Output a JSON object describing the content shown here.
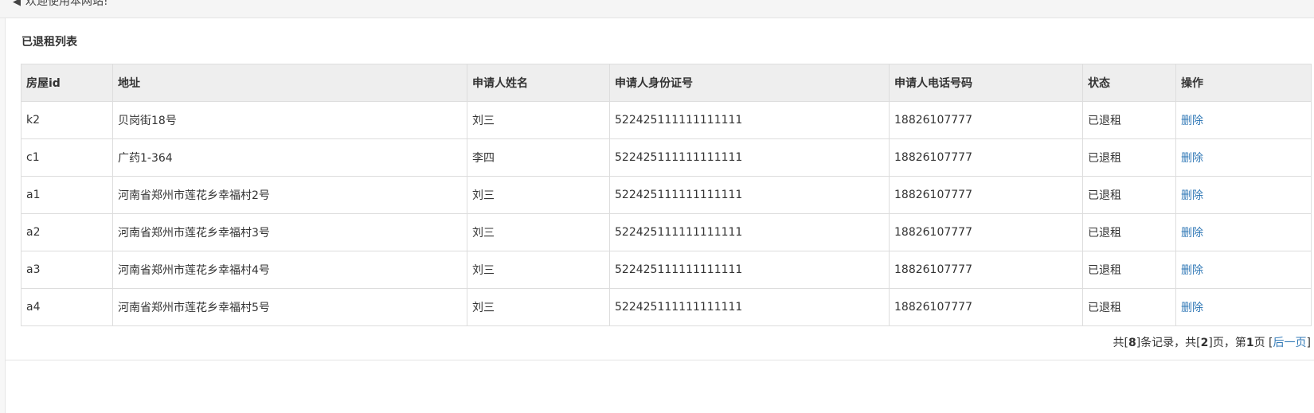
{
  "header": {
    "welcome_text": "欢迎使用本网站!",
    "icon": "speaker-icon"
  },
  "section": {
    "title": "已退租列表"
  },
  "table": {
    "columns": [
      "房屋id",
      "地址",
      "申请人姓名",
      "申请人身份证号",
      "申请人电话号码",
      "状态",
      "操作"
    ],
    "rows": [
      {
        "id": "k2",
        "address": "贝岗街18号",
        "name": "刘三",
        "id_card": "522425111111111111",
        "phone": "18826107777",
        "status": "已退租",
        "action": "删除"
      },
      {
        "id": "c1",
        "address": "广药1-364",
        "name": "李四",
        "id_card": "522425111111111111",
        "phone": "18826107777",
        "status": "已退租",
        "action": "删除"
      },
      {
        "id": "a1",
        "address": "河南省郑州市莲花乡幸福村2号",
        "name": "刘三",
        "id_card": "522425111111111111",
        "phone": "18826107777",
        "status": "已退租",
        "action": "删除"
      },
      {
        "id": "a2",
        "address": "河南省郑州市莲花乡幸福村3号",
        "name": "刘三",
        "id_card": "522425111111111111",
        "phone": "18826107777",
        "status": "已退租",
        "action": "删除"
      },
      {
        "id": "a3",
        "address": "河南省郑州市莲花乡幸福村4号",
        "name": "刘三",
        "id_card": "522425111111111111",
        "phone": "18826107777",
        "status": "已退租",
        "action": "删除"
      },
      {
        "id": "a4",
        "address": "河南省郑州市莲花乡幸福村5号",
        "name": "刘三",
        "id_card": "522425111111111111",
        "phone": "18826107777",
        "status": "已退租",
        "action": "删除"
      }
    ]
  },
  "pager": {
    "prefix": "共[",
    "total_records": "8",
    "records_suffix": "]条记录，共[",
    "total_pages": "2",
    "pages_suffix": "]页，第",
    "current_page": "1",
    "current_suffix": "页 [",
    "next_label": "后一页",
    "close": "]"
  },
  "colors": {
    "link": "#337ab7",
    "header_bg": "#eeeeee",
    "border": "#dddddd"
  }
}
